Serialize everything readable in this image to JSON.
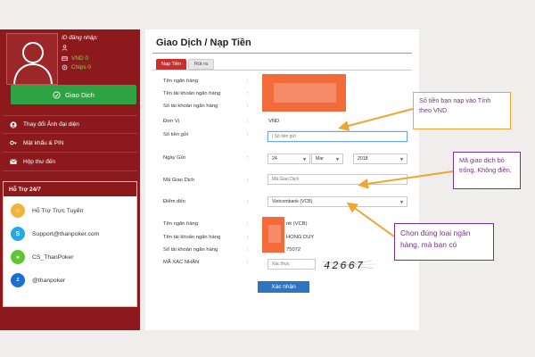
{
  "profile": {
    "id_label": "ID đăng nhập:",
    "vnd": "VND 0",
    "chips": "Chips 0",
    "transaction_button": "Giao Dịch"
  },
  "menu": {
    "items": [
      {
        "label": "Thay đổi Ảnh đại diện",
        "icon": "user-icon"
      },
      {
        "label": "Mật khẩu & PIN",
        "icon": "key-icon"
      },
      {
        "label": "Hộp thư đến",
        "icon": "mail-icon"
      }
    ]
  },
  "support": {
    "title": "Hỗ Trợ 24/7",
    "items": [
      {
        "label": "Hỗ Trợ Trực Tuyến",
        "icon": "live-support-icon",
        "color": "#f2b33d"
      },
      {
        "label": "Support@thanpoker.com",
        "icon": "skype-icon",
        "color": "#27a7e7"
      },
      {
        "label": "CS_ThanPoker",
        "icon": "wechat-icon",
        "color": "#5ec832"
      },
      {
        "label": "@thanpoker",
        "icon": "zalo-icon",
        "color": "#1b6fd1"
      }
    ]
  },
  "main": {
    "title": "Giao Dịch / Nạp Tiền",
    "tabs": [
      "Nạp Tiền",
      "Rút ra"
    ],
    "labels": {
      "bank_name": "Tên ngân hàng",
      "account_name": "Tên tài khoản ngân hàng",
      "account_number": "Số tài khoản ngân hàng",
      "unit": "Đơn Vị",
      "amount": "Số tiền gửi",
      "date": "Ngày Gửi",
      "transaction_code": "Mã Giao Dịch",
      "destination": "Điểm đến",
      "bank_name2": "Tên ngân hàng",
      "account_name2": "Tên tài khoản ngân hàng",
      "account_number2": "Số tài khoản ngân hàng",
      "captcha": "MÃ XÁC NHẬN"
    },
    "unit_value": "VND",
    "amount_placeholder": "| Số tiền gửi",
    "date": {
      "day": "24",
      "month": "Mar",
      "year": "2018"
    },
    "transaction_placeholder": "Mã Giao Dịch",
    "destination_value": "Vietcombank (VCB)",
    "bank_name2_partial": "nk (VCB)",
    "account_name2_partial": "HONG DUY",
    "account_number2_partial": "75072",
    "captcha_placeholder": "Xác thực",
    "captcha_code": "42667",
    "submit": "Xác nhận"
  },
  "callouts": {
    "amount": "Số tiền bạn nạp vào Tính theo VND",
    "transaction": "Mã giao dịch bỏ trống. Không điền.",
    "bank": "Chọn đúng loại ngân hàng, mà bạn có"
  },
  "colors": {
    "sidebar": "#8c1a1c",
    "green_button": "#2ea343",
    "tab_active": "#c9302c",
    "submit": "#2f74c0",
    "redaction": "#f36a3b",
    "arrow": "#f0a532",
    "callout_text": "#7a2f8c"
  }
}
